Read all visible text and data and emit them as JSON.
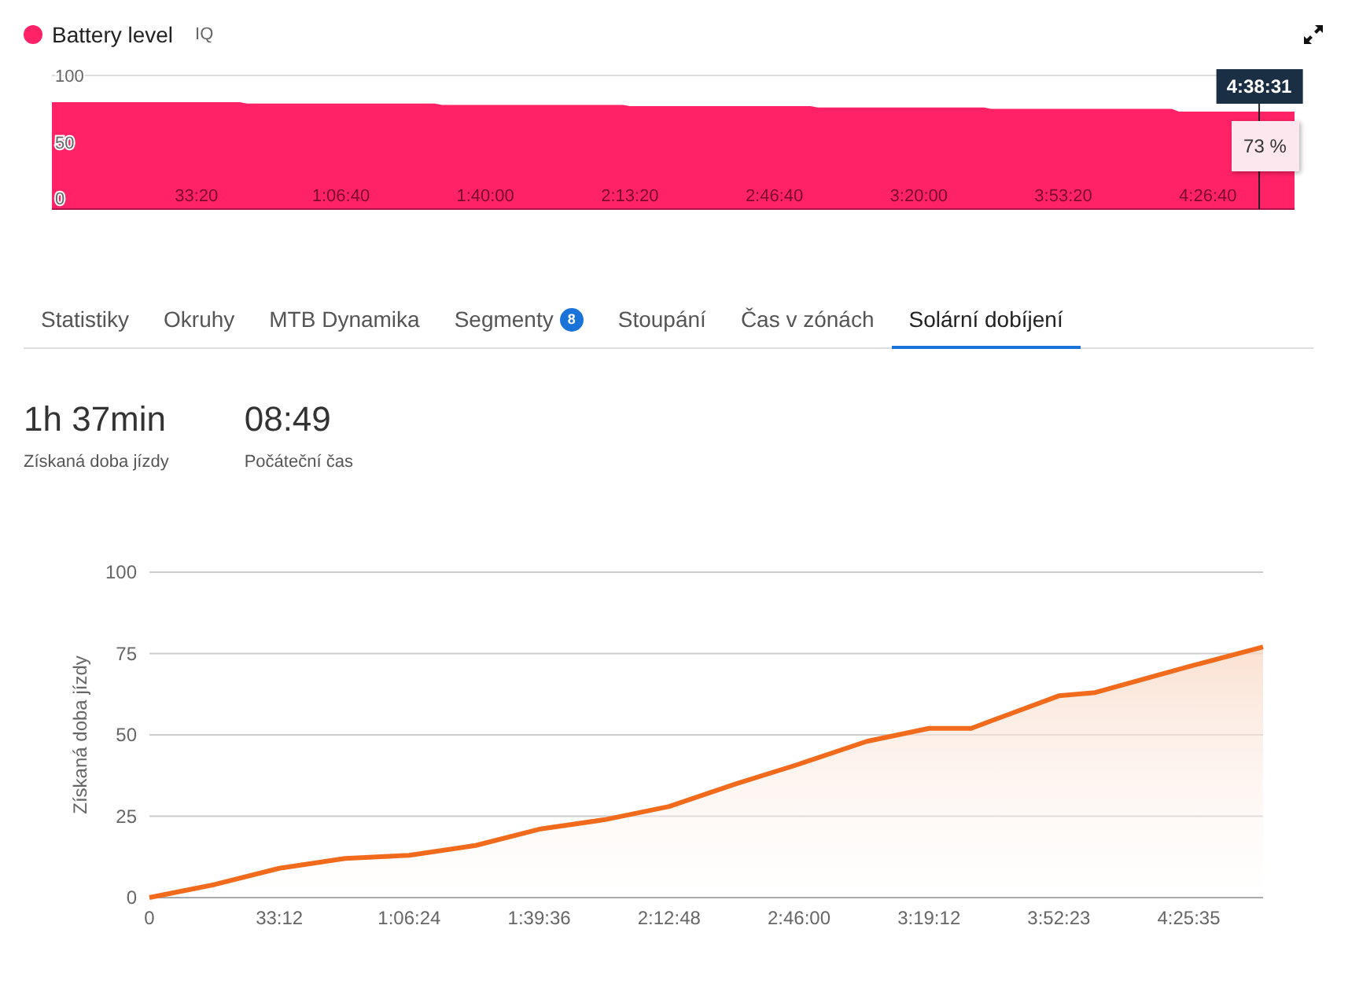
{
  "battery_chart": {
    "badge": "IQ",
    "chart_data": {
      "type": "area",
      "xlim": [
        0,
        17200
      ],
      "ylim": [
        0,
        100
      ],
      "ref_lines": [
        {
          "axis": "x",
          "value": 16711,
          "color": "#222222"
        }
      ],
      "yticks": [
        0,
        50,
        100
      ],
      "xticks": [
        {
          "value": 2000,
          "label": "33:20"
        },
        {
          "value": 4000,
          "label": "1:06:40"
        },
        {
          "value": 6000,
          "label": "1:40:00"
        },
        {
          "value": 8000,
          "label": "2:13:20"
        },
        {
          "value": 10000,
          "label": "2:46:40"
        },
        {
          "value": 12000,
          "label": "3:20:00"
        },
        {
          "value": 14000,
          "label": "3:53:20"
        },
        {
          "value": 16000,
          "label": "4:26:40"
        }
      ],
      "x": [
        0,
        500,
        2600,
        2700,
        5300,
        5400,
        7900,
        8000,
        10500,
        10600,
        12900,
        13000,
        15500,
        15600,
        17200
      ],
      "series": [
        {
          "name": "Battery level",
          "color": "#ff2266",
          "values": [
            80,
            80,
            80,
            79,
            79,
            78,
            78,
            77,
            77,
            76,
            76,
            75,
            75,
            73,
            73
          ]
        }
      ]
    },
    "tooltip": {
      "time": "4:38:31",
      "value": "73 %"
    }
  },
  "tabs": [
    {
      "label": "Statistiky",
      "selected": false
    },
    {
      "label": "Okruhy",
      "selected": false
    },
    {
      "label": "MTB Dynamika",
      "selected": false
    },
    {
      "label": "Segmenty",
      "count": "8",
      "selected": false
    },
    {
      "label": "Stoupání",
      "selected": false
    },
    {
      "label": "Čas v zónách",
      "selected": false
    },
    {
      "label": "Solární dobíjení",
      "selected": true
    }
  ],
  "stats": [
    {
      "value": "1h 37min",
      "label": "Získaná doba jízdy"
    },
    {
      "value": "08:49",
      "label": "Počáteční čas"
    }
  ],
  "charging_chart": {
    "chart_data": {
      "type": "area",
      "grid": true,
      "ylabel": "Získaná doba jízdy",
      "xlim": [
        0,
        17074
      ],
      "ylim": [
        0,
        100
      ],
      "yticks": [
        0,
        25,
        50,
        75,
        100
      ],
      "xticks": [
        {
          "value": 0,
          "label": "0"
        },
        {
          "value": 1992,
          "label": "33:12"
        },
        {
          "value": 3984,
          "label": "1:06:24"
        },
        {
          "value": 5976,
          "label": "1:39:36"
        },
        {
          "value": 7968,
          "label": "2:12:48"
        },
        {
          "value": 9960,
          "label": "2:46:00"
        },
        {
          "value": 11952,
          "label": "3:19:12"
        },
        {
          "value": 13943,
          "label": "3:52:23"
        },
        {
          "value": 15935,
          "label": "4:25:35"
        }
      ],
      "x": [
        0,
        1000,
        1992,
        3000,
        3984,
        5000,
        5976,
        7000,
        7968,
        9000,
        9960,
        11000,
        11952,
        12600,
        13000,
        13943,
        14500,
        15935,
        17074
      ],
      "series": [
        {
          "color": "#f26b1d",
          "values": [
            0,
            4,
            9,
            12,
            13,
            16,
            21,
            24,
            28,
            35,
            41,
            48,
            52,
            52,
            55,
            62,
            63,
            71,
            77
          ]
        }
      ]
    }
  }
}
